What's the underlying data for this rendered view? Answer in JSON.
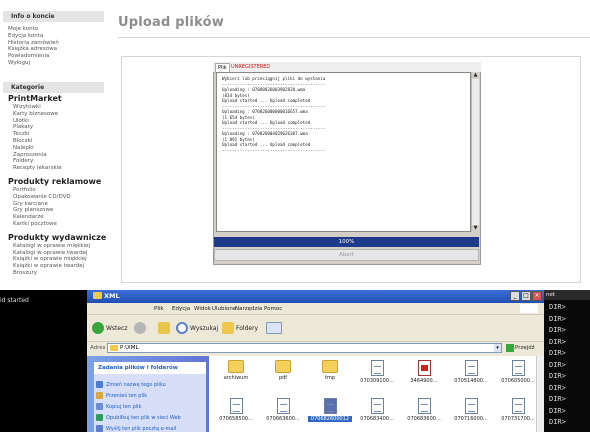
{
  "sidebar": {
    "account_head": "Info o koncie",
    "account_links": [
      "Moje konto",
      "Edycja konta",
      "Historia zamówień",
      "Książka adresowa",
      "Powiadomienia",
      "Wyloguj"
    ],
    "categories_head": "Kategorie",
    "sections": [
      {
        "title": "PrintMarket",
        "items": [
          "Wizytówki",
          "Karty biznesowe",
          "Ulotki",
          "Plakaty",
          "Teczki",
          "Bloczki",
          "Nalepki",
          "Zaproszenia",
          "Foldery",
          "Recepty lekarskie"
        ]
      },
      {
        "title": "Produkty reklamowe",
        "items": [
          "Portfolio",
          "Opakowanie CD/DVD",
          "Gry karciane",
          "Gry planszowe",
          "Kalendarze",
          "Kartki pocztowe"
        ]
      },
      {
        "title": "Produkty wydawnicze",
        "items": [
          "Katalogi w oprawie miękkiej",
          "Katalogi w oprawie twardej",
          "Książki w oprawie miękkiej",
          "Książki w oprawie twardej",
          "Broszury"
        ]
      }
    ]
  },
  "main": {
    "title": "Upload plików"
  },
  "applet": {
    "tab_file": "Plik",
    "tab_unregistered": "UNREGISTERED",
    "log_lines": [
      "Wybierz lub przeciągnij pliki do wysłania",
      "-----------------------------------------",
      "Uploading : 07080826003902820.wma",
      "(834 bytes)",
      "Upload started ... Upload completed",
      "-----------------------------------------",
      "Uploading : 070826000000016657.wma",
      "(1 654 bytes)",
      "Upload started ... Upload completed",
      "-----------------------------------------",
      "Uploading : 070826004029626307.wma",
      "(1 091 bytes)",
      "Upload started ... Upload completed",
      "-----------------------------------------"
    ],
    "progress": "100%",
    "progress_fraction": 1.0,
    "abort_label": "Abort"
  },
  "taskbar": {
    "started_label": "id started"
  },
  "explorer": {
    "title": "XML",
    "menu": [
      "Plik",
      "Edycja",
      "Widok",
      "Ulubione",
      "Narzędzia",
      "Pomoc"
    ],
    "toolbar": {
      "back": "Wstecz",
      "search": "Wyszukaj",
      "folders": "Foldery"
    },
    "address_label": "Adres",
    "address_value": "P:\\XML",
    "go_label": "Przejdź",
    "task_pane": {
      "header": "Zadania plików i folderów",
      "links": [
        "Zmień nazwę tego pliku",
        "Przenieś ten plik",
        "Kopiuj ten plik",
        "Opublikuj ten plik w sieci Web",
        "Wyślij ten plik pocztą e-mail"
      ]
    },
    "files_row1": [
      {
        "name": "archiwum",
        "type": "folder"
      },
      {
        "name": "pdf",
        "type": "folder"
      },
      {
        "name": "tmp",
        "type": "folder"
      },
      {
        "name": "070309100...",
        "type": "doc"
      },
      {
        "name": "3464900...",
        "type": "pdf"
      },
      {
        "name": "070514800...",
        "type": "doc"
      },
      {
        "name": "070605000...",
        "type": "doc"
      }
    ],
    "files_row2": [
      {
        "name": "070658500...",
        "type": "doc",
        "selected": false
      },
      {
        "name": "070663600...",
        "type": "doc",
        "selected": false
      },
      {
        "name": "070682600012",
        "type": "doc",
        "selected": true
      },
      {
        "name": "070683400...",
        "type": "doc",
        "selected": false
      },
      {
        "name": "070683600...",
        "type": "doc",
        "selected": false
      },
      {
        "name": "070716000...",
        "type": "doc",
        "selected": false
      },
      {
        "name": "070731700...",
        "type": "doc",
        "selected": false
      }
    ]
  },
  "terminal": {
    "title": "net",
    "lines": [
      "DIR>",
      "DIR>",
      "DIR>",
      "DIR>",
      "DIR>",
      "DIR>",
      "DIR>",
      "DIR>",
      "DIR>",
      "DIR>",
      "DIR>"
    ]
  }
}
